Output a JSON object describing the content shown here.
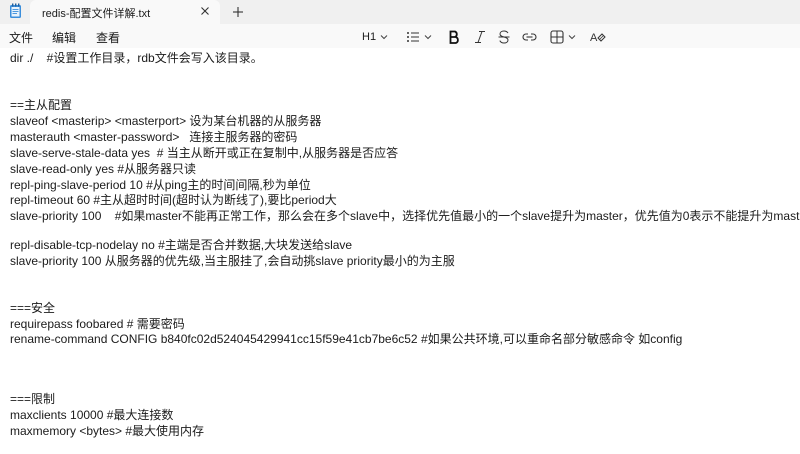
{
  "window": {
    "tab_title": "redis-配置文件详解.txt",
    "app_icon": "notepad-icon",
    "close_icon": "close-icon",
    "new_tab_icon": "plus-icon"
  },
  "menu": {
    "file": "文件",
    "edit": "编辑",
    "view": "查看"
  },
  "toolbar": {
    "heading": "H1",
    "heading_icon": "chevron-down-icon",
    "list_icon": "bulleted-list-icon",
    "bold_icon": "bold-icon",
    "italic_icon": "italic-icon",
    "strike_icon": "strikethrough-icon",
    "link_icon": "link-icon",
    "table_icon": "table-icon",
    "clear_format_icon": "clear-formatting-icon"
  },
  "editor": {
    "lines": [
      "dir ./    #设置工作目录，rdb文件会写入该目录。",
      "",
      "",
      "==主从配置",
      "slaveof <masterip> <masterport> 设为某台机器的从服务器",
      "masterauth <master-password>   连接主服务器的密码",
      "slave-serve-stale-data yes  # 当主从断开或正在复制中,从服务器是否应答",
      "slave-read-only yes #从服务器只读",
      "repl-ping-slave-period 10 #从ping主的时间间隔,秒为单位",
      "repl-timeout 60 #主从超时时间(超时认为断线了),要比period大",
      "slave-priority 100    #如果master不能再正常工作，那么会在多个slave中，选择优先值最小的一个slave提升为master，优先值为0表示不能提升为mast",
      "",
      "repl-disable-tcp-nodelay no #主端是否合并数据,大块发送给slave",
      "slave-priority 100 从服务器的优先级,当主服挂了,会自动挑slave priority最小的为主服",
      "",
      "",
      "===安全",
      "requirepass foobared # 需要密码",
      "rename-command CONFIG b840fc02d524045429941cc15f59e41cb7be6c52 #如果公共环境,可以重命名部分敏感命令 如config",
      "",
      "",
      "",
      "===限制",
      "maxclients 10000 #最大连接数",
      "maxmemory <bytes> #最大使用内存"
    ]
  }
}
